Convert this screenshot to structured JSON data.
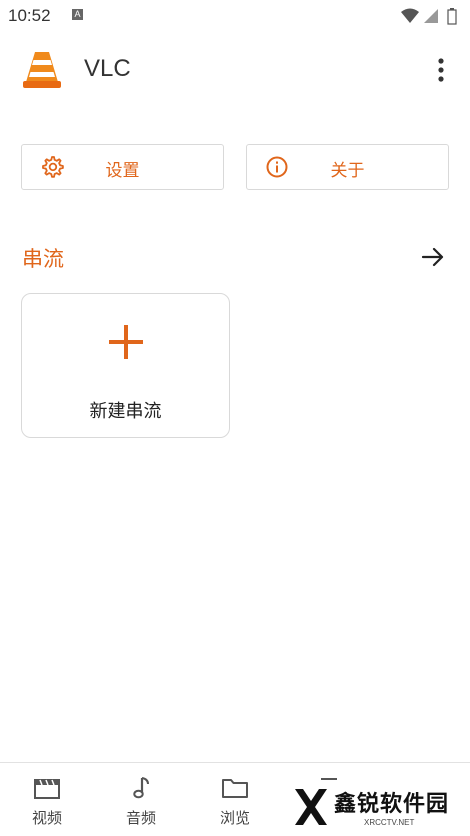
{
  "status_bar": {
    "time": "10:52",
    "badge": "A"
  },
  "app_bar": {
    "title": "VLC"
  },
  "buttons": {
    "settings_label": "设置",
    "about_label": "关于"
  },
  "streams": {
    "section_title": "串流",
    "new_stream_label": "新建串流"
  },
  "bottom_nav": {
    "items": [
      {
        "label": "视频",
        "icon": "film-icon"
      },
      {
        "label": "音频",
        "icon": "music-note-icon"
      },
      {
        "label": "浏览",
        "icon": "folder-icon"
      },
      {
        "label": "",
        "icon": "more-icon"
      }
    ]
  },
  "watermark": {
    "text": "鑫锐软件园",
    "sub": "XRCCTV.NET"
  },
  "colors": {
    "accent": "#e0661b",
    "text": "#222222",
    "border": "#d9d9d9"
  }
}
